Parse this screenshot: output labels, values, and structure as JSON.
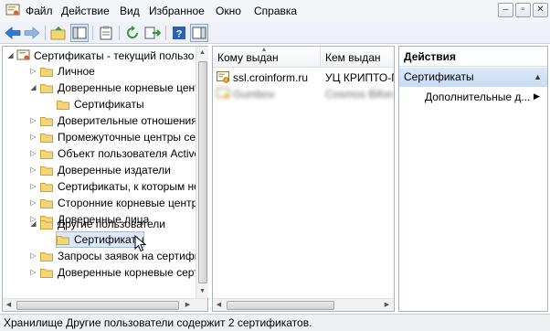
{
  "menu": {
    "items": [
      "Файл",
      "Действие",
      "Вид",
      "Избранное",
      "Окно",
      "Справка"
    ]
  },
  "window_controls": {
    "minimize": "‒",
    "restore": "▫",
    "close": "✕"
  },
  "tree": {
    "root": "Сертификаты - текущий пользо",
    "items": [
      {
        "label": "Личное",
        "expanded": false
      },
      {
        "label": "Доверенные корневые центр",
        "expanded": true
      },
      {
        "label": "Сертификаты",
        "child": true
      },
      {
        "label": "Доверительные отношения в",
        "expanded": false
      },
      {
        "label": "Промежуточные центры серт",
        "expanded": false
      },
      {
        "label": "Объект пользователя Active D",
        "expanded": false
      },
      {
        "label": "Доверенные издатели",
        "expanded": false
      },
      {
        "label": "Сертификаты, к которым нет",
        "expanded": false
      },
      {
        "label": "Сторонние корневые центры",
        "expanded": false
      },
      {
        "label": "Доверенные лица",
        "expanded": false
      },
      {
        "label": "Другие пользователи",
        "expanded": true
      },
      {
        "label": "Сертификаты",
        "child": true,
        "selected": true
      },
      {
        "label": "Запросы заявок на сертифик",
        "expanded": false
      },
      {
        "label": "Доверенные корневые сертиф",
        "expanded": false
      }
    ]
  },
  "list": {
    "columns": [
      "Кому выдан",
      "Кем выдан"
    ],
    "rows": [
      {
        "issued_to": "ssl.croinform.ru",
        "issued_by": "УЦ КРИПТО-П"
      },
      {
        "issued_to": "Gumbov",
        "issued_by": "Cosmos Bifondo"
      }
    ]
  },
  "actions": {
    "title": "Действия",
    "section": "Сертификаты",
    "items": [
      "Дополнительные д..."
    ]
  },
  "status": {
    "text": "Хранилище Другие пользователи содержит 2 сертификатов."
  },
  "colors": {
    "menubar_bg": "#f3f5f9",
    "selection": "#dce8f7",
    "folder": "#f3d67a",
    "actions_section": "#c9dcf3"
  }
}
